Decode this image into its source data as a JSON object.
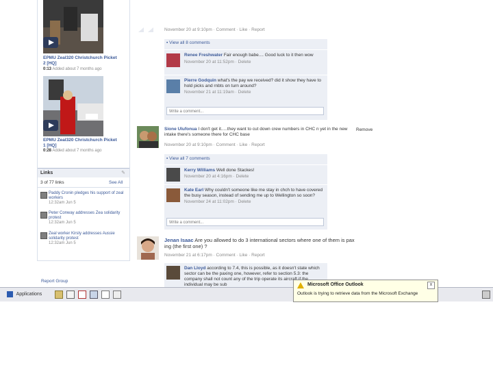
{
  "left_column": {
    "videos": [
      {
        "title": "EPMU Zeal320 Christchurch Picket 2 [HQ]",
        "meta": "0:13 Added about 7 months ago",
        "duration": "0:13",
        "added": "Added about 7 months ago"
      },
      {
        "title": "EPMU Zeal320 Christchurch Picket 1 [HQ]",
        "meta": "0:28 Added about 7 months ago",
        "duration": "0:28",
        "added": "Added about 7 months ago"
      }
    ],
    "links_box": {
      "title": "Links",
      "count": "3 of 77 links",
      "see_all": "See All",
      "items": [
        {
          "text": "Paddy Cronin pledges his support of zeal workers",
          "date": "12:32am Jun 5"
        },
        {
          "text": "Peter Conway addresses Zea solidarity protest",
          "date": "12:32am Jun 5"
        },
        {
          "text": "Zeal worker Kirsty addresses Aussie solidarity protest",
          "date": "12:32am Jun 5"
        }
      ]
    },
    "report_group": "Report Group"
  },
  "feed": {
    "top_post_meta": "November 20 at 9:10pm · Comment · Like · Report",
    "thread1": {
      "view_all": "View all 8 comments",
      "comments": [
        {
          "name": "Renee Freshwater",
          "text": "Fair enough babe.... Good luck to it then wow",
          "meta": "November 20 at 11:52pm · Delete"
        },
        {
          "name": "Pierre Godquin",
          "text": "what's the pay we received? did it show they have to hold picks and rnbts on turn around?",
          "meta": "November 21 at 11:19am · Delete"
        }
      ],
      "write_placeholder": "Write a comment..."
    },
    "post2": {
      "name": "Sione Ulufonua",
      "text": "I don't get it.....they want to cut down crew numbers in CHC n yet in the new intake there's someone there for CHC base",
      "remove": "Remove",
      "meta": "November 20 at 9:10pm · Comment · Like · Report"
    },
    "thread2": {
      "view_all": "View all 7 comments",
      "comments": [
        {
          "name": "Kerry Williams",
          "text": "Well done Stackes!",
          "meta": "November 20 at 4:16pm · Delete"
        },
        {
          "name": "Kate Earl",
          "text": "Why couldn't someone like me stay in chch to have covered the busy season, instead of sending me up to Wellington so soon?",
          "meta": "November 24 at 11:02pm · Delete"
        }
      ],
      "write_placeholder": "Write a comment..."
    },
    "post3": {
      "name": "Jenan Isaac",
      "text": "Are you allowed to do 3 international sectors where one of them is pax ing (the first one) ?",
      "meta": "November 21 at 6:17pm · Comment · Like · Report"
    },
    "thread3": {
      "comments": [
        {
          "name": "Dan Lloyd",
          "text": "according to 7.4, this is possible, as it doesn't state which sector can be the paxing one, however, refer to section 5.3: the company shall not count any of the trip operate its aircraft if the individual may be sub"
        }
      ]
    }
  },
  "taskbar": {
    "start_label": "Applications",
    "icons": [
      "folder-icon",
      "doc-icon",
      "calendar-icon",
      "mail-icon",
      "list-icon",
      "window-icon"
    ]
  },
  "popup": {
    "title": "Microsoft Office Outlook",
    "body": "Outlook is trying to retrieve data from the Microsoft Exchange",
    "close": "x"
  },
  "colors": {
    "fb_blue": "#3b5998",
    "comment_bg": "#eceff5",
    "taskbar": "#e8e9ee",
    "popup_bg": "#ffffe6"
  }
}
